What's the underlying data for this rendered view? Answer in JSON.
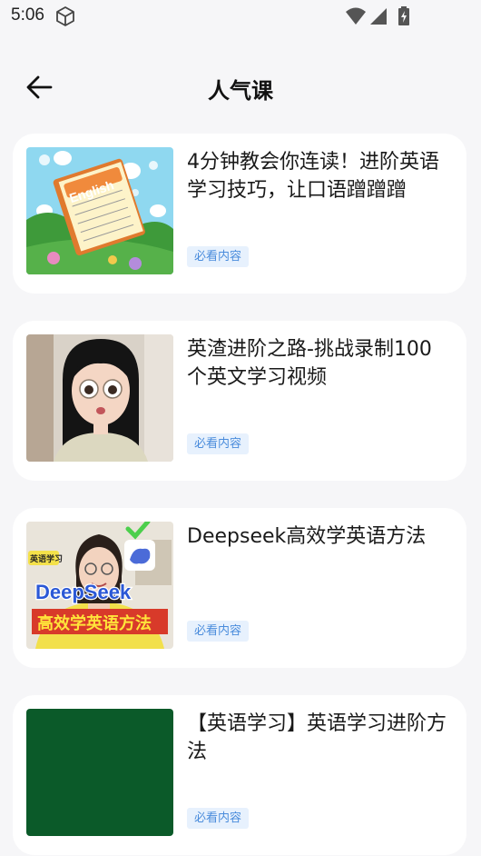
{
  "status_bar": {
    "time": "5:06"
  },
  "header": {
    "title": "人气课"
  },
  "courses": [
    {
      "title": "4分钟教会你连读！进阶英语学习技巧，让口语蹭蹭蹭",
      "badge": "必看内容",
      "thumb_text": "English"
    },
    {
      "title": "英渣进阶之路-挑战录制100个英文学习视频",
      "badge": "必看内容"
    },
    {
      "title": "Deepseek高效学英语方法",
      "badge": "必看内容",
      "thumb_tag": "英语学习",
      "thumb_title": "DeepSeek",
      "thumb_subtitle": "高效学英语方法"
    },
    {
      "title": "【英语学习】英语学习进阶方法",
      "badge": "必看内容"
    }
  ]
}
